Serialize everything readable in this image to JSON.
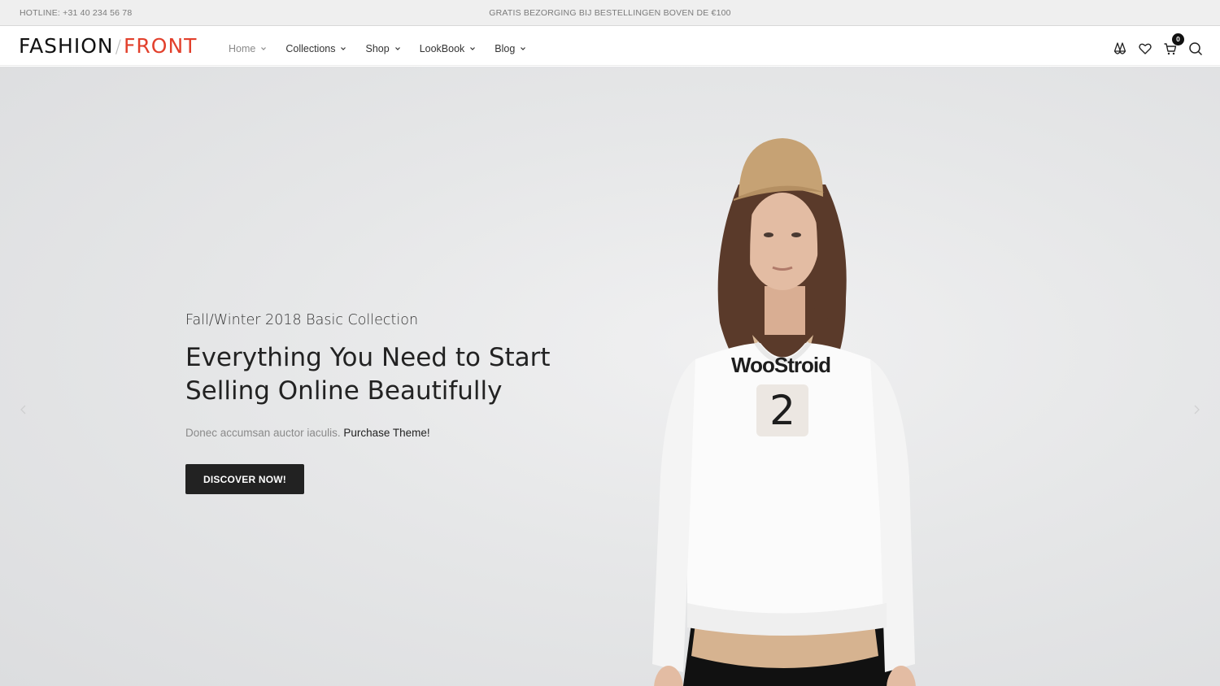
{
  "topbar": {
    "hotline": "HOTLINE: +31 40 234 56 78",
    "promo": "GRATIS BEZORGING BIJ BESTELLINGEN BOVEN DE €100"
  },
  "header": {
    "logo_part1": "FASHION",
    "logo_slash": "/",
    "logo_part2": "FRONT",
    "nav": [
      {
        "label": "Home",
        "active": true
      },
      {
        "label": "Collections"
      },
      {
        "label": "Shop"
      },
      {
        "label": "LookBook"
      },
      {
        "label": "Blog"
      }
    ],
    "icons": [
      "compare-icon",
      "heart-icon",
      "cart-icon",
      "search-icon"
    ],
    "cart_count": "0"
  },
  "hero": {
    "subtitle": "Fall/Winter 2018 Basic Collection",
    "title": "Everything You Need to Start Selling Online Beautifully",
    "description": "Donec accumsan auctor iaculis.",
    "description_link": "Purchase Theme!",
    "button_label": "DISCOVER NOW!",
    "shirt_brand": "WooStroid",
    "shirt_number": "2"
  },
  "colors": {
    "brand_accent": "#e2402c",
    "button_bg": "#222222",
    "topbar_bg": "#efefef"
  }
}
